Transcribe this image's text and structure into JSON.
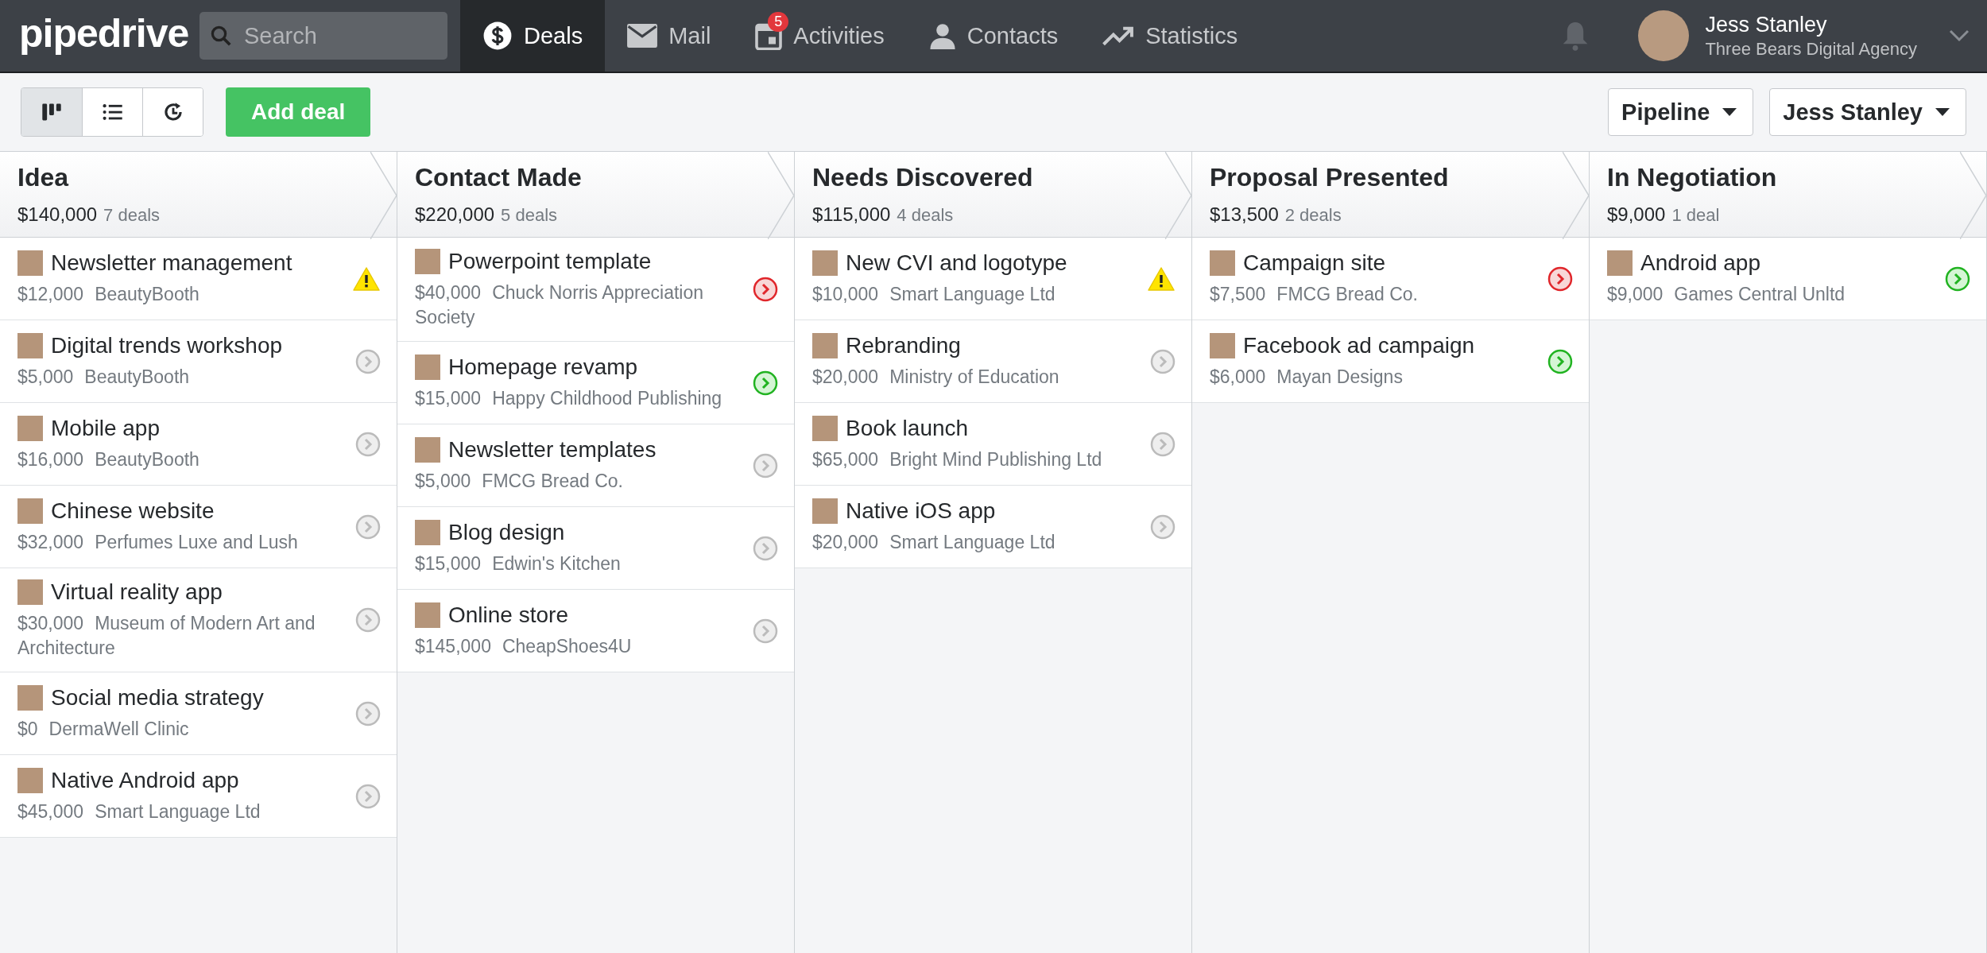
{
  "logo": "pipedrive",
  "search": {
    "placeholder": "Search"
  },
  "nav": [
    {
      "label": "Deals",
      "kind": "dollar",
      "selected": true
    },
    {
      "label": "Mail",
      "kind": "mail",
      "selected": false
    },
    {
      "label": "Activities",
      "kind": "calendar",
      "selected": false,
      "badge": "5"
    },
    {
      "label": "Contacts",
      "kind": "person",
      "selected": false
    },
    {
      "label": "Statistics",
      "kind": "trend",
      "selected": false
    }
  ],
  "user": {
    "name": "Jess Stanley",
    "company": "Three Bears Digital Agency"
  },
  "view_buttons": [
    {
      "kind": "kanban",
      "selected": true
    },
    {
      "kind": "list",
      "selected": false
    },
    {
      "kind": "forecast",
      "selected": false
    }
  ],
  "add_button": "Add deal",
  "filters": [
    "Pipeline",
    "Jess Stanley"
  ],
  "stages": [
    {
      "name": "Idea",
      "total": "$140,000",
      "count": "7 deals",
      "deals": [
        {
          "title": "Newsletter management",
          "value": "$12,000",
          "org": "BeautyBooth",
          "kind": "warning"
        },
        {
          "title": "Digital trends workshop",
          "value": "$5,000",
          "org": "BeautyBooth",
          "kind": "none"
        },
        {
          "title": "Mobile app",
          "value": "$16,000",
          "org": "BeautyBooth",
          "kind": "none"
        },
        {
          "title": "Chinese website",
          "value": "$32,000",
          "org": "Perfumes Luxe and Lush",
          "kind": "none"
        },
        {
          "title": "Virtual reality app",
          "value": "$30,000",
          "org": "Museum of Modern Art and Architecture",
          "kind": "none"
        },
        {
          "title": "Social media strategy",
          "value": "$0",
          "org": "DermaWell Clinic",
          "kind": "none"
        },
        {
          "title": "Native Android app",
          "value": "$45,000",
          "org": "Smart Language Ltd",
          "kind": "none"
        }
      ]
    },
    {
      "name": "Contact Made",
      "total": "$220,000",
      "count": "5 deals",
      "deals": [
        {
          "title": "Powerpoint template",
          "value": "$40,000",
          "org": "Chuck Norris Appreciation Society",
          "kind": "overdue"
        },
        {
          "title": "Homepage revamp",
          "value": "$15,000",
          "org": "Happy Childhood Publishing",
          "kind": "planned"
        },
        {
          "title": "Newsletter templates",
          "value": "$5,000",
          "org": "FMCG Bread Co.",
          "kind": "none"
        },
        {
          "title": "Blog design",
          "value": "$15,000",
          "org": "Edwin's Kitchen",
          "kind": "none"
        },
        {
          "title": "Online store",
          "value": "$145,000",
          "org": "CheapShoes4U",
          "kind": "none"
        }
      ]
    },
    {
      "name": "Needs Discovered",
      "total": "$115,000",
      "count": "4 deals",
      "deals": [
        {
          "title": "New CVI and logotype",
          "value": "$10,000",
          "org": "Smart Language Ltd",
          "kind": "warning"
        },
        {
          "title": "Rebranding",
          "value": "$20,000",
          "org": "Ministry of Education",
          "kind": "none"
        },
        {
          "title": "Book launch",
          "value": "$65,000",
          "org": "Bright Mind Publishing Ltd",
          "kind": "none"
        },
        {
          "title": "Native iOS app",
          "value": "$20,000",
          "org": "Smart Language Ltd",
          "kind": "none"
        }
      ]
    },
    {
      "name": "Proposal Presented",
      "total": "$13,500",
      "count": "2 deals",
      "deals": [
        {
          "title": "Campaign site",
          "value": "$7,500",
          "org": "FMCG Bread Co.",
          "kind": "overdue"
        },
        {
          "title": "Facebook ad campaign",
          "value": "$6,000",
          "org": "Mayan Designs",
          "kind": "planned"
        }
      ]
    },
    {
      "name": "In Negotiation",
      "total": "$9,000",
      "count": "1 deal",
      "deals": [
        {
          "title": "Android app",
          "value": "$9,000",
          "org": "Games Central Unltd",
          "kind": "planned"
        }
      ]
    }
  ]
}
